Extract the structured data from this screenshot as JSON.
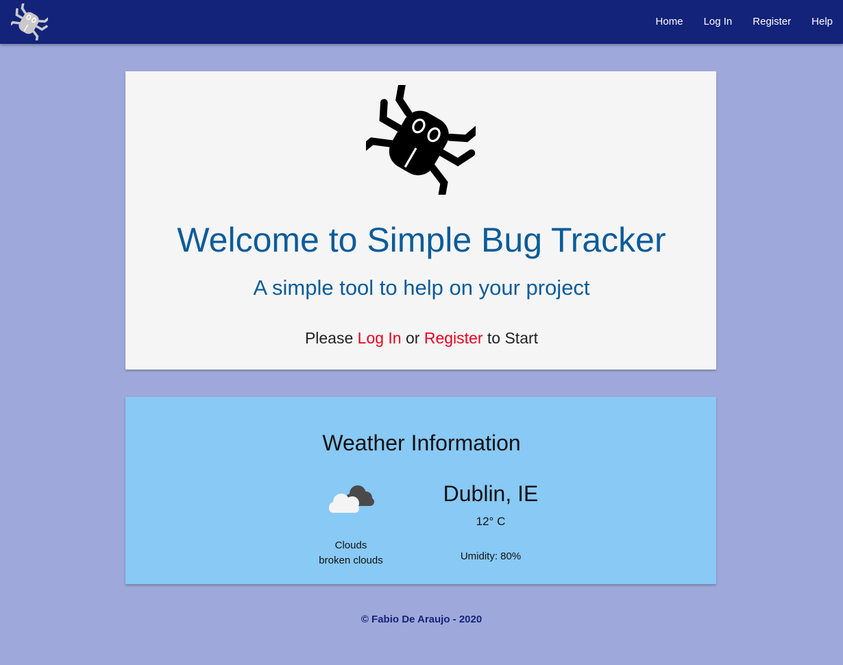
{
  "nav": {
    "logo_icon": "bug-logo-icon",
    "links": [
      "Home",
      "Log In",
      "Register",
      "Help"
    ]
  },
  "welcome": {
    "logo_icon": "bug-icon",
    "title": "Welcome to Simple Bug Tracker",
    "subtitle": "A simple tool to help on your project",
    "cta_prefix": "Please",
    "login_link": "Log In",
    "cta_or": "or",
    "register_link": "Register",
    "cta_suffix": "to Start"
  },
  "weather": {
    "title": "Weather Information",
    "icon": "broken-clouds-icon",
    "condition": "Clouds",
    "description": "broken clouds",
    "city": "Dublin, IE",
    "temperature": "12° C",
    "humidity": "Umidity: 80%"
  },
  "footer": {
    "copyright": "© Fabio De Araujo - 2020"
  },
  "colors": {
    "navbar": "#13237a",
    "page_background": "#9fa8da",
    "welcome_card": "#f5f5f5",
    "weather_card": "#88c9f5",
    "title_blue": "#0b5c9a",
    "link_red": "#e8001c"
  }
}
